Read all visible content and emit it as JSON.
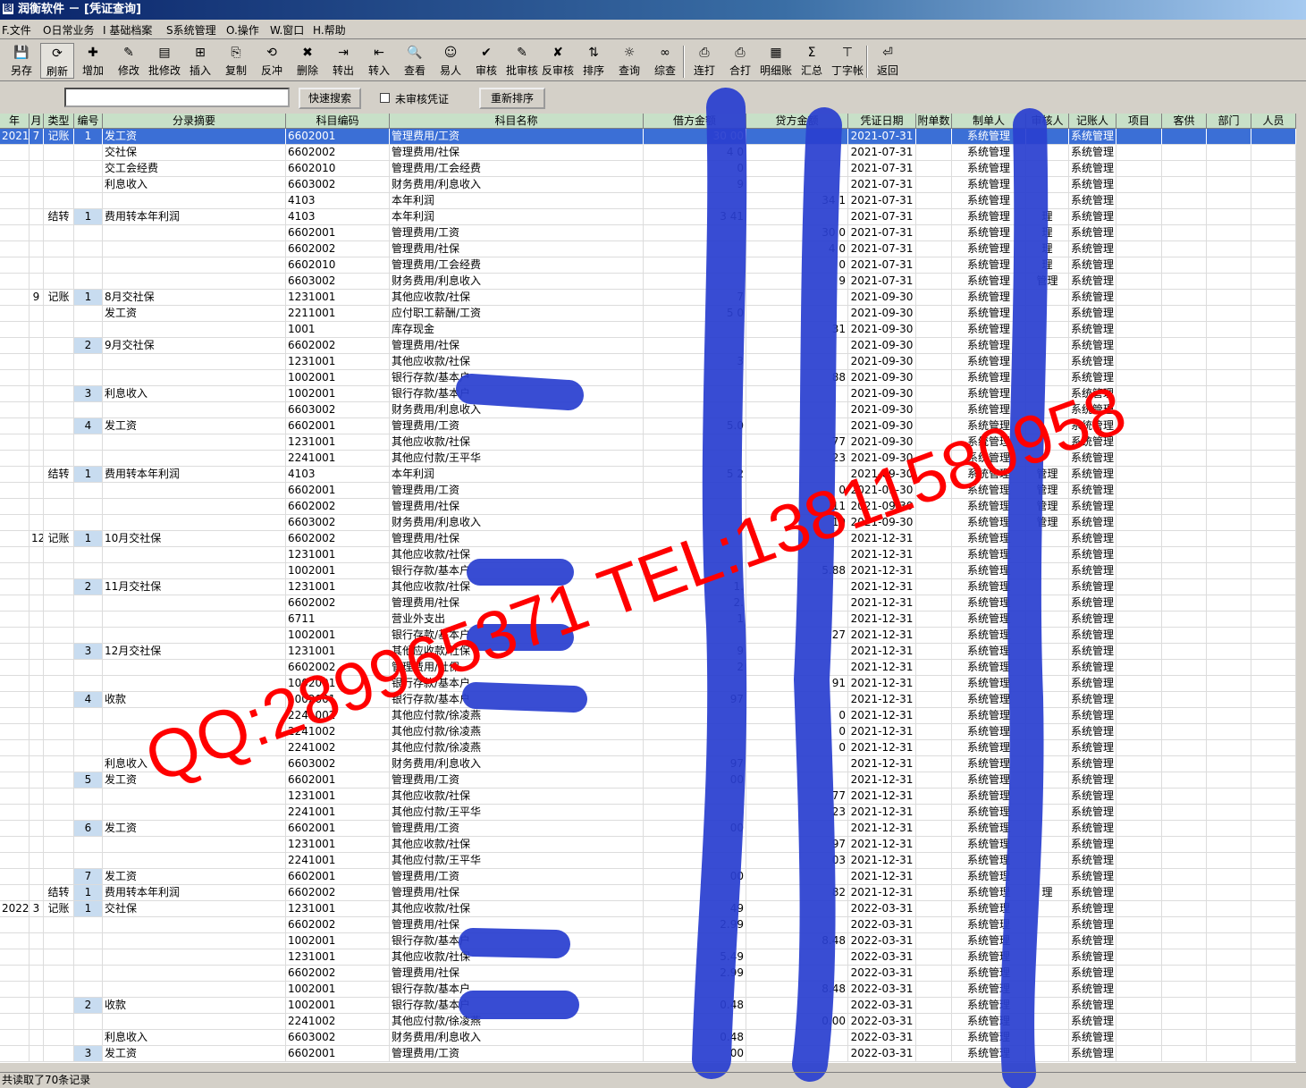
{
  "window": {
    "title": "润衡软件 － [凭证查询]"
  },
  "menu": [
    "F.文件",
    "O日常业务",
    "I 基础档案",
    "S系统管理",
    "O.操作",
    "W.窗口",
    "H.帮助"
  ],
  "toolbar": [
    {
      "label": "另存",
      "icon": "save-icon",
      "glyph": "💾"
    },
    {
      "label": "刷新",
      "icon": "refresh-icon",
      "glyph": "⟳"
    },
    {
      "label": "增加",
      "icon": "add-icon",
      "glyph": "✚"
    },
    {
      "label": "修改",
      "icon": "edit-icon",
      "glyph": "✎"
    },
    {
      "label": "批修改",
      "icon": "batch-edit-icon",
      "glyph": "▤"
    },
    {
      "label": "插入",
      "icon": "insert-icon",
      "glyph": "⊞"
    },
    {
      "label": "复制",
      "icon": "copy-icon",
      "glyph": "⎘"
    },
    {
      "label": "反冲",
      "icon": "reverse-icon",
      "glyph": "⟲"
    },
    {
      "label": "删除",
      "icon": "delete-icon",
      "glyph": "✖"
    },
    {
      "label": "转出",
      "icon": "export-icon",
      "glyph": "⇥"
    },
    {
      "label": "转入",
      "icon": "import-icon",
      "glyph": "⇤"
    },
    {
      "label": "查看",
      "icon": "view-icon",
      "glyph": "🔍"
    },
    {
      "label": "易人",
      "icon": "change-person-icon",
      "glyph": "☺"
    },
    {
      "label": "审核",
      "icon": "audit-icon",
      "glyph": "✔"
    },
    {
      "label": "批审核",
      "icon": "batch-audit-icon",
      "glyph": "✎"
    },
    {
      "label": "反审核",
      "icon": "unaudit-icon",
      "glyph": "✘"
    },
    {
      "label": "排序",
      "icon": "sort-icon",
      "glyph": "⇅"
    },
    {
      "label": "查询",
      "icon": "query-icon",
      "glyph": "☼"
    },
    {
      "label": "综查",
      "icon": "binoculars-icon",
      "glyph": "∞"
    },
    {
      "label": "连打",
      "icon": "print-continuous-icon",
      "glyph": "⎙"
    },
    {
      "label": "合打",
      "icon": "print-merge-icon",
      "glyph": "⎙"
    },
    {
      "label": "明细账",
      "icon": "detail-ledger-icon",
      "glyph": "▦"
    },
    {
      "label": "汇总",
      "icon": "sum-icon",
      "glyph": "Σ"
    },
    {
      "label": "丁字帐",
      "icon": "t-account-icon",
      "glyph": "⊤"
    },
    {
      "label": "返回",
      "icon": "return-icon",
      "glyph": "⏎"
    }
  ],
  "search": {
    "value": "",
    "quick_search_label": "快速搜索",
    "unaudited_label": "未审核凭证",
    "resort_label": "重新排序"
  },
  "columns": [
    "年",
    "月",
    "类型",
    "编号",
    "分录摘要",
    "科目编码",
    "科目名称",
    "借方金额",
    "贷方金额",
    "凭证日期",
    "附单数",
    "制单人",
    "审核人",
    "记账人",
    "项目",
    "客供",
    "部门",
    "人员"
  ],
  "rows": [
    [
      "2021",
      "7",
      "记账",
      "1",
      "发工资",
      "6602001",
      "管理费用/工资",
      "30  00",
      "",
      "2021-07-31",
      "",
      "系统管理",
      "",
      "系统管理"
    ],
    [
      "",
      "",
      "",
      "",
      "交社保",
      "6602002",
      "管理费用/社保",
      "4  0",
      "",
      "2021-07-31",
      "",
      "系统管理",
      "",
      "系统管理"
    ],
    [
      "",
      "",
      "",
      "",
      "交工会经费",
      "6602010",
      "管理费用/工会经费",
      "0",
      "",
      "2021-07-31",
      "",
      "系统管理",
      "",
      "系统管理"
    ],
    [
      "",
      "",
      "",
      "",
      "利息收入",
      "6603002",
      "财务费用/利息收入",
      "9",
      "",
      "2021-07-31",
      "",
      "系统管理",
      "",
      "系统管理"
    ],
    [
      "",
      "",
      "",
      "",
      "",
      "4103",
      "本年利润",
      "",
      "34  1",
      "2021-07-31",
      "",
      "系统管理",
      "",
      "系统管理"
    ],
    [
      "",
      "",
      "结转",
      "1",
      "费用转本年利润",
      "4103",
      "本年利润",
      "3  41",
      "",
      "2021-07-31",
      "",
      "系统管理",
      "理",
      "系统管理"
    ],
    [
      "",
      "",
      "",
      "",
      "",
      "6602001",
      "管理费用/工资",
      "",
      "30  0",
      "2021-07-31",
      "",
      "系统管理",
      "理",
      "系统管理"
    ],
    [
      "",
      "",
      "",
      "",
      "",
      "6602002",
      "管理费用/社保",
      "",
      "4  0",
      "2021-07-31",
      "",
      "系统管理",
      "理",
      "系统管理"
    ],
    [
      "",
      "",
      "",
      "",
      "",
      "6602010",
      "管理费用/工会经费",
      "",
      "0",
      "2021-07-31",
      "",
      "系统管理",
      "理",
      "系统管理"
    ],
    [
      "",
      "",
      "",
      "",
      "",
      "6603002",
      "财务费用/利息收入",
      "",
      "9",
      "2021-07-31",
      "",
      "系统管理",
      "管理",
      "系统管理"
    ],
    [
      "",
      "9",
      "记账",
      "1",
      "8月交社保",
      "1231001",
      "其他应收款/社保",
      "7",
      "",
      "2021-09-30",
      "",
      "系统管理",
      "",
      "系统管理"
    ],
    [
      "",
      "",
      "",
      "",
      "发工资",
      "2211001",
      "应付职工薪酬/工资",
      "5  0",
      "",
      "2021-09-30",
      "",
      "系统管理",
      "",
      "系统管理"
    ],
    [
      "",
      "",
      "",
      "",
      "",
      "1001",
      "库存现金",
      "",
      "31",
      "2021-09-30",
      "",
      "系统管理",
      "",
      "系统管理"
    ],
    [
      "",
      "",
      "",
      "2",
      "9月交社保",
      "6602002",
      "管理费用/社保",
      "",
      "",
      "2021-09-30",
      "",
      "系统管理",
      "",
      "系统管理"
    ],
    [
      "",
      "",
      "",
      "",
      "",
      "1231001",
      "其他应收款/社保",
      "3",
      "",
      "2021-09-30",
      "",
      "系统管理",
      "",
      "系统管理"
    ],
    [
      "",
      "",
      "",
      "",
      "",
      "1002001",
      "银行存款/基本户",
      "",
      "88",
      "2021-09-30",
      "",
      "系统管理",
      "",
      "系统管理"
    ],
    [
      "",
      "",
      "",
      "3",
      "利息收入",
      "1002001",
      "银行存款/基本户",
      "",
      "",
      "2021-09-30",
      "",
      "系统管理",
      "",
      "系统管理"
    ],
    [
      "",
      "",
      "",
      "",
      "",
      "6603002",
      "财务费用/利息收入",
      "",
      "",
      "2021-09-30",
      "",
      "系统管理",
      "",
      "系统管理"
    ],
    [
      "",
      "",
      "",
      "4",
      "发工资",
      "6602001",
      "管理费用/工资",
      "5.0",
      "",
      "2021-09-30",
      "",
      "系统管理",
      "",
      "系统管理"
    ],
    [
      "",
      "",
      "",
      "",
      "",
      "1231001",
      "其他应收款/社保",
      "",
      "77",
      "2021-09-30",
      "",
      "系统管理",
      "",
      "系统管理"
    ],
    [
      "",
      "",
      "",
      "",
      "",
      "2241001",
      "其他应付款/王平华",
      "",
      "23",
      "2021-09-30",
      "",
      "系统管理",
      "",
      "系统管理"
    ],
    [
      "",
      "",
      "结转",
      "1",
      "费用转本年利润",
      "4103",
      "本年利润",
      "5  2",
      "",
      "2021-09-30",
      "",
      "系统管理",
      "管理",
      "系统管理"
    ],
    [
      "",
      "",
      "",
      "",
      "",
      "6602001",
      "管理费用/工资",
      "",
      "0",
      "2021-09-30",
      "",
      "系统管理",
      "管理",
      "系统管理"
    ],
    [
      "",
      "",
      "",
      "",
      "",
      "6602002",
      "管理费用/社保",
      "",
      "11",
      "2021-09-30",
      "",
      "系统管理",
      "管理",
      "系统管理"
    ],
    [
      "",
      "",
      "",
      "",
      "",
      "6603002",
      "财务费用/利息收入",
      "",
      "19",
      "2021-09-30",
      "",
      "系统管理",
      "管理",
      "系统管理"
    ],
    [
      "",
      "12",
      "记账",
      "1",
      "10月交社保",
      "6602002",
      "管理费用/社保",
      "",
      "",
      "2021-12-31",
      "",
      "系统管理",
      "",
      "系统管理"
    ],
    [
      "",
      "",
      "",
      "",
      "",
      "1231001",
      "其他应收款/社保",
      "",
      "",
      "2021-12-31",
      "",
      "系统管理",
      "",
      "系统管理"
    ],
    [
      "",
      "",
      "",
      "",
      "",
      "1002001",
      "银行存款/基本户",
      "",
      "5.88",
      "2021-12-31",
      "",
      "系统管理",
      "",
      "系统管理"
    ],
    [
      "",
      "",
      "",
      "2",
      "11月交社保",
      "1231001",
      "其他应收款/社保",
      "1.",
      "",
      "2021-12-31",
      "",
      "系统管理",
      "",
      "系统管理"
    ],
    [
      "",
      "",
      "",
      "",
      "",
      "6602002",
      "管理费用/社保",
      "2.",
      "",
      "2021-12-31",
      "",
      "系统管理",
      "",
      "系统管理"
    ],
    [
      "",
      "",
      "",
      "",
      "",
      "6711",
      "营业外支出",
      "1",
      "",
      "2021-12-31",
      "",
      "系统管理",
      "",
      "系统管理"
    ],
    [
      "",
      "",
      "",
      "",
      "",
      "1002001",
      "银行存款/基本户",
      "",
      "27",
      "2021-12-31",
      "",
      "系统管理",
      "",
      "系统管理"
    ],
    [
      "",
      "",
      "",
      "3",
      "12月交社保",
      "1231001",
      "其他应收款/社保",
      "9",
      "",
      "2021-12-31",
      "",
      "系统管理",
      "",
      "系统管理"
    ],
    [
      "",
      "",
      "",
      "",
      "",
      "6602002",
      "管理费用/社保",
      "2",
      "",
      "2021-12-31",
      "",
      "系统管理",
      "",
      "系统管理"
    ],
    [
      "",
      "",
      "",
      "",
      "",
      "1002001",
      "银行存款/基本户",
      "",
      "91",
      "2021-12-31",
      "",
      "系统管理",
      "",
      "系统管理"
    ],
    [
      "",
      "",
      "",
      "4",
      "收款",
      "1002001",
      "银行存款/基本户",
      "97",
      "",
      "2021-12-31",
      "",
      "系统管理",
      "",
      "系统管理"
    ],
    [
      "",
      "",
      "",
      "",
      "",
      "2241002",
      "其他应付款/徐凌燕",
      "",
      "0",
      "2021-12-31",
      "",
      "系统管理",
      "",
      "系统管理"
    ],
    [
      "",
      "",
      "",
      "",
      "",
      "2241002",
      "其他应付款/徐凌燕",
      "",
      "0",
      "2021-12-31",
      "",
      "系统管理",
      "",
      "系统管理"
    ],
    [
      "",
      "",
      "",
      "",
      "",
      "2241002",
      "其他应付款/徐凌燕",
      "",
      "0",
      "2021-12-31",
      "",
      "系统管理",
      "",
      "系统管理"
    ],
    [
      "",
      "",
      "",
      "",
      "利息收入",
      "6603002",
      "财务费用/利息收入",
      "97",
      "",
      "2021-12-31",
      "",
      "系统管理",
      "",
      "系统管理"
    ],
    [
      "",
      "",
      "",
      "5",
      "发工资",
      "6602001",
      "管理费用/工资",
      "00",
      "",
      "2021-12-31",
      "",
      "系统管理",
      "",
      "系统管理"
    ],
    [
      "",
      "",
      "",
      "",
      "",
      "1231001",
      "其他应收款/社保",
      "",
      "77",
      "2021-12-31",
      "",
      "系统管理",
      "",
      "系统管理"
    ],
    [
      "",
      "",
      "",
      "",
      "",
      "2241001",
      "其他应付款/王平华",
      "",
      "23",
      "2021-12-31",
      "",
      "系统管理",
      "",
      "系统管理"
    ],
    [
      "",
      "",
      "",
      "6",
      "发工资",
      "6602001",
      "管理费用/工资",
      "00",
      "",
      "2021-12-31",
      "",
      "系统管理",
      "",
      "系统管理"
    ],
    [
      "",
      "",
      "",
      "",
      "",
      "1231001",
      "其他应收款/社保",
      "",
      "97",
      "2021-12-31",
      "",
      "系统管理",
      "",
      "系统管理"
    ],
    [
      "",
      "",
      "",
      "",
      "",
      "2241001",
      "其他应付款/王平华",
      "",
      "03",
      "2021-12-31",
      "",
      "系统管理",
      "",
      "系统管理"
    ],
    [
      "",
      "",
      "",
      "7",
      "发工资",
      "6602001",
      "管理费用/工资",
      "00",
      "",
      "2021-12-31",
      "",
      "系统管理",
      "",
      "系统管理"
    ],
    [
      "",
      "",
      "结转",
      "1",
      "费用转本年利润",
      "6602002",
      "管理费用/社保",
      "",
      "82",
      "2021-12-31",
      "",
      "系统管理",
      "理",
      "系统管理"
    ],
    [
      "2022",
      "3",
      "记账",
      "1",
      "交社保",
      "1231001",
      "其他应收款/社保",
      "49",
      "",
      "2022-03-31",
      "",
      "系统管理",
      "",
      "系统管理"
    ],
    [
      "",
      "",
      "",
      "",
      "",
      "6602002",
      "管理费用/社保",
      "2.99",
      "",
      "2022-03-31",
      "",
      "系统管理",
      "",
      "系统管理"
    ],
    [
      "",
      "",
      "",
      "",
      "",
      "1002001",
      "银行存款/基本户",
      "",
      "8.48",
      "2022-03-31",
      "",
      "系统管理",
      "",
      "系统管理"
    ],
    [
      "",
      "",
      "",
      "",
      "",
      "1231001",
      "其他应收款/社保",
      "5.49",
      "",
      "2022-03-31",
      "",
      "系统管理",
      "",
      "系统管理"
    ],
    [
      "",
      "",
      "",
      "",
      "",
      "6602002",
      "管理费用/社保",
      "2.99",
      "",
      "2022-03-31",
      "",
      "系统管理",
      "",
      "系统管理"
    ],
    [
      "",
      "",
      "",
      "",
      "",
      "1002001",
      "银行存款/基本户",
      "",
      "8.48",
      "2022-03-31",
      "",
      "系统管理",
      "",
      "系统管理"
    ],
    [
      "",
      "",
      "",
      "2",
      "收款",
      "1002001",
      "银行存款/基本户",
      "0.48",
      "",
      "2022-03-31",
      "",
      "系统管理",
      "",
      "系统管理"
    ],
    [
      "",
      "",
      "",
      "",
      "",
      "2241002",
      "其他应付款/徐凌燕",
      "",
      "0.00",
      "2022-03-31",
      "",
      "系统管理",
      "",
      "系统管理"
    ],
    [
      "",
      "",
      "",
      "",
      "利息收入",
      "6603002",
      "财务费用/利息收入",
      "0.48",
      "",
      "2022-03-31",
      "",
      "系统管理",
      "",
      "系统管理"
    ],
    [
      "",
      "",
      "",
      "3",
      "发工资",
      "6602001",
      "管理费用/工资",
      "00",
      "",
      "2022-03-31",
      "",
      "系统管理",
      "",
      "系统管理"
    ]
  ],
  "status": "共读取了70条记录",
  "watermark": "QQ:289965371 TEL:13811580958",
  "colors": {
    "header_bg": "#c8e0c8",
    "selection": "#3b6fd6",
    "number_cell": "#c8dcf0",
    "scribble": "#2a3fd0",
    "watermark": "#ff0000"
  }
}
